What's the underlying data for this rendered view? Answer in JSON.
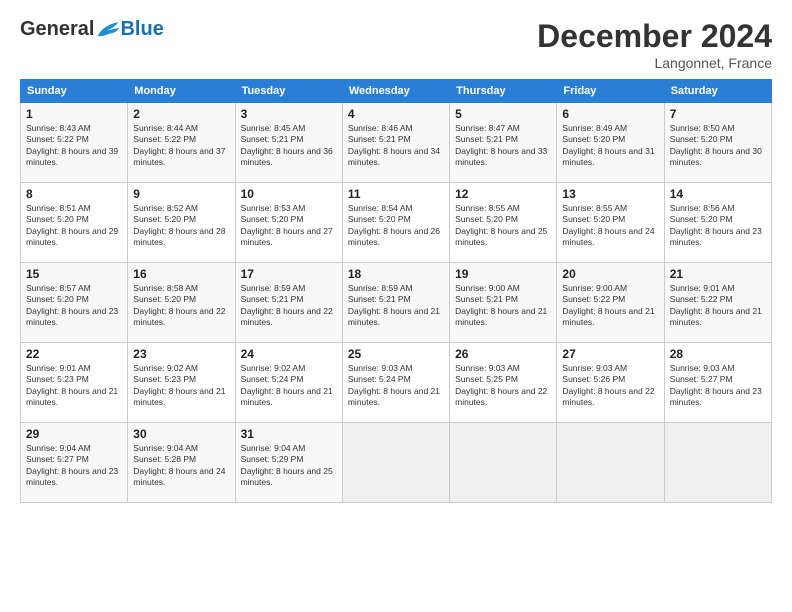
{
  "logo": {
    "general": "General",
    "blue": "Blue"
  },
  "header": {
    "title": "December 2024",
    "subtitle": "Langonnet, France"
  },
  "weekdays": [
    "Sunday",
    "Monday",
    "Tuesday",
    "Wednesday",
    "Thursday",
    "Friday",
    "Saturday"
  ],
  "weeks": [
    [
      {
        "day": "1",
        "sunrise": "Sunrise: 8:43 AM",
        "sunset": "Sunset: 5:22 PM",
        "daylight": "Daylight: 8 hours and 39 minutes."
      },
      {
        "day": "2",
        "sunrise": "Sunrise: 8:44 AM",
        "sunset": "Sunset: 5:22 PM",
        "daylight": "Daylight: 8 hours and 37 minutes."
      },
      {
        "day": "3",
        "sunrise": "Sunrise: 8:45 AM",
        "sunset": "Sunset: 5:21 PM",
        "daylight": "Daylight: 8 hours and 36 minutes."
      },
      {
        "day": "4",
        "sunrise": "Sunrise: 8:46 AM",
        "sunset": "Sunset: 5:21 PM",
        "daylight": "Daylight: 8 hours and 34 minutes."
      },
      {
        "day": "5",
        "sunrise": "Sunrise: 8:47 AM",
        "sunset": "Sunset: 5:21 PM",
        "daylight": "Daylight: 8 hours and 33 minutes."
      },
      {
        "day": "6",
        "sunrise": "Sunrise: 8:49 AM",
        "sunset": "Sunset: 5:20 PM",
        "daylight": "Daylight: 8 hours and 31 minutes."
      },
      {
        "day": "7",
        "sunrise": "Sunrise: 8:50 AM",
        "sunset": "Sunset: 5:20 PM",
        "daylight": "Daylight: 8 hours and 30 minutes."
      }
    ],
    [
      {
        "day": "8",
        "sunrise": "Sunrise: 8:51 AM",
        "sunset": "Sunset: 5:20 PM",
        "daylight": "Daylight: 8 hours and 29 minutes."
      },
      {
        "day": "9",
        "sunrise": "Sunrise: 8:52 AM",
        "sunset": "Sunset: 5:20 PM",
        "daylight": "Daylight: 8 hours and 28 minutes."
      },
      {
        "day": "10",
        "sunrise": "Sunrise: 8:53 AM",
        "sunset": "Sunset: 5:20 PM",
        "daylight": "Daylight: 8 hours and 27 minutes."
      },
      {
        "day": "11",
        "sunrise": "Sunrise: 8:54 AM",
        "sunset": "Sunset: 5:20 PM",
        "daylight": "Daylight: 8 hours and 26 minutes."
      },
      {
        "day": "12",
        "sunrise": "Sunrise: 8:55 AM",
        "sunset": "Sunset: 5:20 PM",
        "daylight": "Daylight: 8 hours and 25 minutes."
      },
      {
        "day": "13",
        "sunrise": "Sunrise: 8:55 AM",
        "sunset": "Sunset: 5:20 PM",
        "daylight": "Daylight: 8 hours and 24 minutes."
      },
      {
        "day": "14",
        "sunrise": "Sunrise: 8:56 AM",
        "sunset": "Sunset: 5:20 PM",
        "daylight": "Daylight: 8 hours and 23 minutes."
      }
    ],
    [
      {
        "day": "15",
        "sunrise": "Sunrise: 8:57 AM",
        "sunset": "Sunset: 5:20 PM",
        "daylight": "Daylight: 8 hours and 23 minutes."
      },
      {
        "day": "16",
        "sunrise": "Sunrise: 8:58 AM",
        "sunset": "Sunset: 5:20 PM",
        "daylight": "Daylight: 8 hours and 22 minutes."
      },
      {
        "day": "17",
        "sunrise": "Sunrise: 8:59 AM",
        "sunset": "Sunset: 5:21 PM",
        "daylight": "Daylight: 8 hours and 22 minutes."
      },
      {
        "day": "18",
        "sunrise": "Sunrise: 8:59 AM",
        "sunset": "Sunset: 5:21 PM",
        "daylight": "Daylight: 8 hours and 21 minutes."
      },
      {
        "day": "19",
        "sunrise": "Sunrise: 9:00 AM",
        "sunset": "Sunset: 5:21 PM",
        "daylight": "Daylight: 8 hours and 21 minutes."
      },
      {
        "day": "20",
        "sunrise": "Sunrise: 9:00 AM",
        "sunset": "Sunset: 5:22 PM",
        "daylight": "Daylight: 8 hours and 21 minutes."
      },
      {
        "day": "21",
        "sunrise": "Sunrise: 9:01 AM",
        "sunset": "Sunset: 5:22 PM",
        "daylight": "Daylight: 8 hours and 21 minutes."
      }
    ],
    [
      {
        "day": "22",
        "sunrise": "Sunrise: 9:01 AM",
        "sunset": "Sunset: 5:23 PM",
        "daylight": "Daylight: 8 hours and 21 minutes."
      },
      {
        "day": "23",
        "sunrise": "Sunrise: 9:02 AM",
        "sunset": "Sunset: 5:23 PM",
        "daylight": "Daylight: 8 hours and 21 minutes."
      },
      {
        "day": "24",
        "sunrise": "Sunrise: 9:02 AM",
        "sunset": "Sunset: 5:24 PM",
        "daylight": "Daylight: 8 hours and 21 minutes."
      },
      {
        "day": "25",
        "sunrise": "Sunrise: 9:03 AM",
        "sunset": "Sunset: 5:24 PM",
        "daylight": "Daylight: 8 hours and 21 minutes."
      },
      {
        "day": "26",
        "sunrise": "Sunrise: 9:03 AM",
        "sunset": "Sunset: 5:25 PM",
        "daylight": "Daylight: 8 hours and 22 minutes."
      },
      {
        "day": "27",
        "sunrise": "Sunrise: 9:03 AM",
        "sunset": "Sunset: 5:26 PM",
        "daylight": "Daylight: 8 hours and 22 minutes."
      },
      {
        "day": "28",
        "sunrise": "Sunrise: 9:03 AM",
        "sunset": "Sunset: 5:27 PM",
        "daylight": "Daylight: 8 hours and 23 minutes."
      }
    ],
    [
      {
        "day": "29",
        "sunrise": "Sunrise: 9:04 AM",
        "sunset": "Sunset: 5:27 PM",
        "daylight": "Daylight: 8 hours and 23 minutes."
      },
      {
        "day": "30",
        "sunrise": "Sunrise: 9:04 AM",
        "sunset": "Sunset: 5:28 PM",
        "daylight": "Daylight: 8 hours and 24 minutes."
      },
      {
        "day": "31",
        "sunrise": "Sunrise: 9:04 AM",
        "sunset": "Sunset: 5:29 PM",
        "daylight": "Daylight: 8 hours and 25 minutes."
      },
      null,
      null,
      null,
      null
    ]
  ]
}
